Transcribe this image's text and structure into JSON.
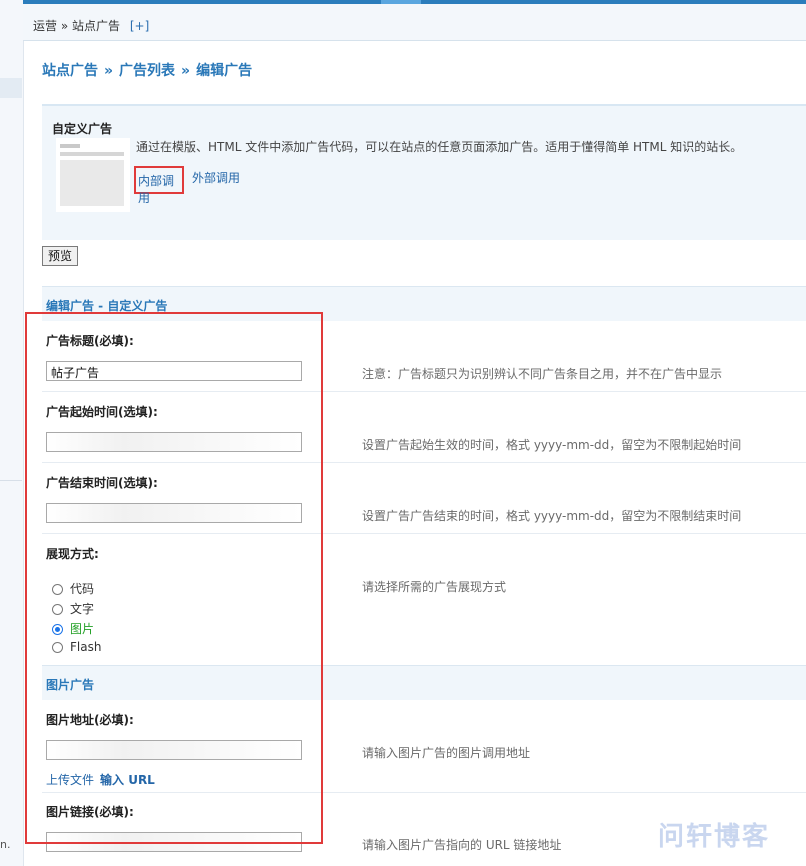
{
  "breadcrumb": {
    "part1": "运营",
    "sep": "»",
    "part2": "站点广告",
    "plus": "[+]"
  },
  "heading": {
    "a": "站点广告",
    "b": "广告列表",
    "c": "编辑广告",
    "sep": "»"
  },
  "adtype": {
    "title": "自定义广告",
    "desc": "通过在模版、HTML 文件中添加广告代码，可以在站点的任意页面添加广告。适用于懂得简单 HTML 知识的站长。",
    "link_internal": "内部调用",
    "link_external": "外部调用"
  },
  "preview_label": "预览",
  "section_edit": "编辑广告 - 自定义广告",
  "fields": {
    "title_label": "广告标题(必填):",
    "title_value": "帖子广告",
    "title_note": "注意：广告标题只为识别辨认不同广告条目之用，并不在广告中显示",
    "start_label": "广告起始时间(选填):",
    "start_note": "设置广告起始生效的时间，格式 yyyy-mm-dd，留空为不限制起始时间",
    "end_label": "广告结束时间(选填):",
    "end_note": "设置广告广告结束的时间，格式 yyyy-mm-dd，留空为不限制结束时间",
    "display_label": "展现方式:",
    "display_note": "请选择所需的广告展现方式",
    "options": [
      "代码",
      "文字",
      "图片",
      "Flash"
    ]
  },
  "section_image": "图片广告",
  "image": {
    "url_label": "图片地址(必填):",
    "url_note": "请输入图片广告的图片调用地址",
    "upload": "上传文件",
    "input_url": "输入 URL",
    "link_label": "图片链接(必填):",
    "link_note": "请输入图片广告指向的 URL 链接地址"
  },
  "watermark": "问轩博客",
  "left_text": "n."
}
